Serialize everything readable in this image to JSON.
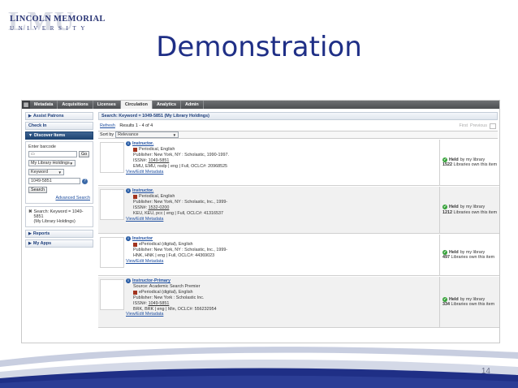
{
  "logo": {
    "watermark": "LMU",
    "line1": "LINCOLN MEMORIAL",
    "line2": "UNIVERSITY"
  },
  "slide": {
    "title": "Demonstration",
    "page_number": "14"
  },
  "colors": {
    "title": "#1f2f86",
    "wave_dark": "#1f2f86",
    "link": "#1f4fa0",
    "held_check": "#36a23a"
  },
  "topnav": {
    "icon": "grid-icon",
    "tabs": [
      "Metadata",
      "Acquisitions",
      "Licenses",
      "Circulation",
      "Analytics",
      "Admin"
    ],
    "active": "Circulation"
  },
  "sidebar": {
    "assist_patrons": "Assist Patrons",
    "check_in": "Check In",
    "discover_items": "Discover Items",
    "enter_barcode_label": "Enter barcode",
    "go_label": "Go",
    "scope_select": "My Library Holdings",
    "index_select": "Keyword",
    "search_value": "1049-5851",
    "search_button": "Search",
    "help_label": "?",
    "advanced_search": "Advanced Search",
    "saved_search_line1": "Search: Keyword = 1049-5851",
    "saved_search_line2": "(My Library Holdings)",
    "reports": "Reports",
    "my_apps": "My Apps"
  },
  "main": {
    "search_header": "Search: Keyword = 1049-5851 (My Library Holdings)",
    "refresh": "Refresh",
    "results": "Results 1 - 4 of 4",
    "pager_first": "First",
    "pager_previous": "Previous",
    "sort_label": "Sort by",
    "sort_value": "Relevance",
    "view_edit": "View/Edit Metadata",
    "held_label_bold": "Held",
    "held_label_rest": "by my library",
    "libraries_suffix": "Libraries own this item",
    "records": [
      {
        "title": "Instructor.",
        "source": "",
        "format": "Periodical, English",
        "publisher": "Publisher: New York, NY : Scholastic, 1990-1997.",
        "issn_label": "ISSN#:",
        "issn": "1049-5851",
        "codes": "EMU, EMU, nsdp | eng | Full, OCLC#: 20968525",
        "libraries": "1522"
      },
      {
        "title": "Instructor.",
        "source": "",
        "format": "Periodical, English",
        "publisher": "Publisher: New York, NY : Scholastic, Inc., 1999-",
        "issn_label": "ISSN#:",
        "issn": "1532-0200",
        "codes": "KEU, KEU, pcc | eng | Full, OCLC#: 41316537",
        "libraries": "1212"
      },
      {
        "title": "Instructor",
        "source": "",
        "format": "ePeriodical (digital), English",
        "publisher": "Publisher: New York, NY : Scholastic, Inc., 1999-",
        "issn_label": "",
        "issn": "",
        "codes": "HNK, HNK | eng | Full, OCLC#: 44369023",
        "libraries": "497"
      },
      {
        "title": "Instructor-Primary",
        "source": "Source: Academic Search Premier",
        "format": "ePeriodical (digital), English",
        "publisher": "Publisher: New York : Scholastic Inc.",
        "issn_label": "ISSN#:",
        "issn": "1049-5851",
        "codes": "BRK, BRK | eng | Min, OCLC#: 556232954",
        "libraries": "334"
      }
    ]
  }
}
